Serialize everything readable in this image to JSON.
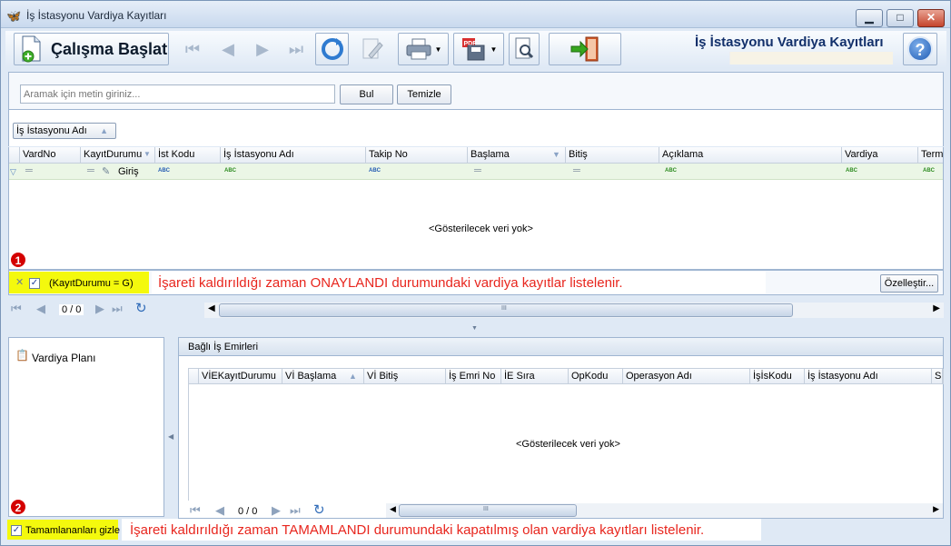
{
  "window": {
    "title": "İş İstasyonu Vardiya Kayıtları",
    "min_label": "▁",
    "max_label": "□",
    "close_label": "✕"
  },
  "toolbar": {
    "start_label": "Çalışma Başlat",
    "header_title": "İş İstasyonu Vardiya Kayıtları",
    "help_label": "?"
  },
  "search": {
    "placeholder": "Aramak için metin giriniz...",
    "find_label": "Bul",
    "clear_label": "Temizle"
  },
  "group": {
    "panel_label": "İş İstasyonu Adı"
  },
  "grid": {
    "columns": [
      "VardNo",
      "KayıtDurumu",
      "İst Kodu",
      "İş İstasyonu Adı",
      "Takip No",
      "Başlama",
      "Bitiş",
      "Açıklama",
      "Vardiya",
      "Term"
    ],
    "filter_row": {
      "status_value": "Giriş",
      "abc": "ABC"
    },
    "empty_text": "<Gösterilecek veri yok>",
    "filter_expression": "(KayıtDurumu = G)",
    "customize_label": "Özelleştir...",
    "pager_text": "0 / 0",
    "scroll_grip": "III"
  },
  "left_panel": {
    "item_label": "Vardiya Planı",
    "checkbox_label": "Tamamlananları gizle"
  },
  "bottom_grid": {
    "tab_label": "Bağlı İş Emirleri",
    "columns": [
      "VİEKayıtDurumu",
      "Vİ Başlama",
      "Vİ Bitiş",
      "İş Emri No",
      "İE Sıra",
      "OpKodu",
      "Operasyon Adı",
      "İşİsKodu",
      "İş İstasyonu Adı",
      "S"
    ],
    "empty_text": "<Gösterilecek veri yok>",
    "pager_text": "0 / 0",
    "scroll_grip": "III"
  },
  "annotations": {
    "badge1": "1",
    "badge2": "2",
    "note1": "İşareti kaldırıldığı zaman ONAYLANDI durumundaki vardiya kayıtlar listelenir.",
    "note2": "İşareti kaldırıldığı zaman TAMAMLANDI durumundaki kapatılmış olan vardiya kayıtları listelenir."
  },
  "colors": {
    "highlight": "#f4f90d",
    "annotation_text": "#e8261e",
    "badge": "#d40000"
  }
}
